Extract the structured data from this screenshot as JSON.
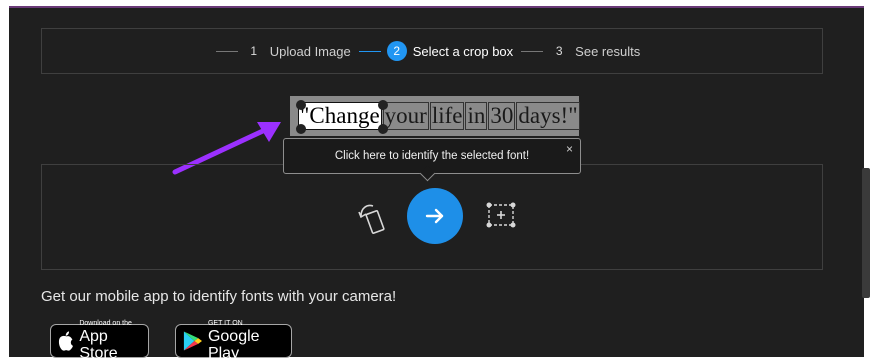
{
  "steps": [
    {
      "num": "1",
      "label": "Upload Image"
    },
    {
      "num": "2",
      "label": "Select a crop box"
    },
    {
      "num": "3",
      "label": "See results"
    }
  ],
  "crop_image": {
    "words": [
      "\"Change",
      "your",
      "life",
      "in",
      "30",
      "days!\""
    ]
  },
  "tooltip": {
    "text": "Click here to identify the selected font!",
    "close": "×"
  },
  "app": {
    "text": "Get our mobile app to identify fonts with your camera!",
    "appstore_small": "Download on the",
    "appstore_big": "App Store",
    "gplay_small": "GET IT ON",
    "gplay_big": "Google Play"
  },
  "colors": {
    "accent": "#2196f3",
    "arrow": "#9b30ff",
    "background": "#1f1f1f"
  }
}
